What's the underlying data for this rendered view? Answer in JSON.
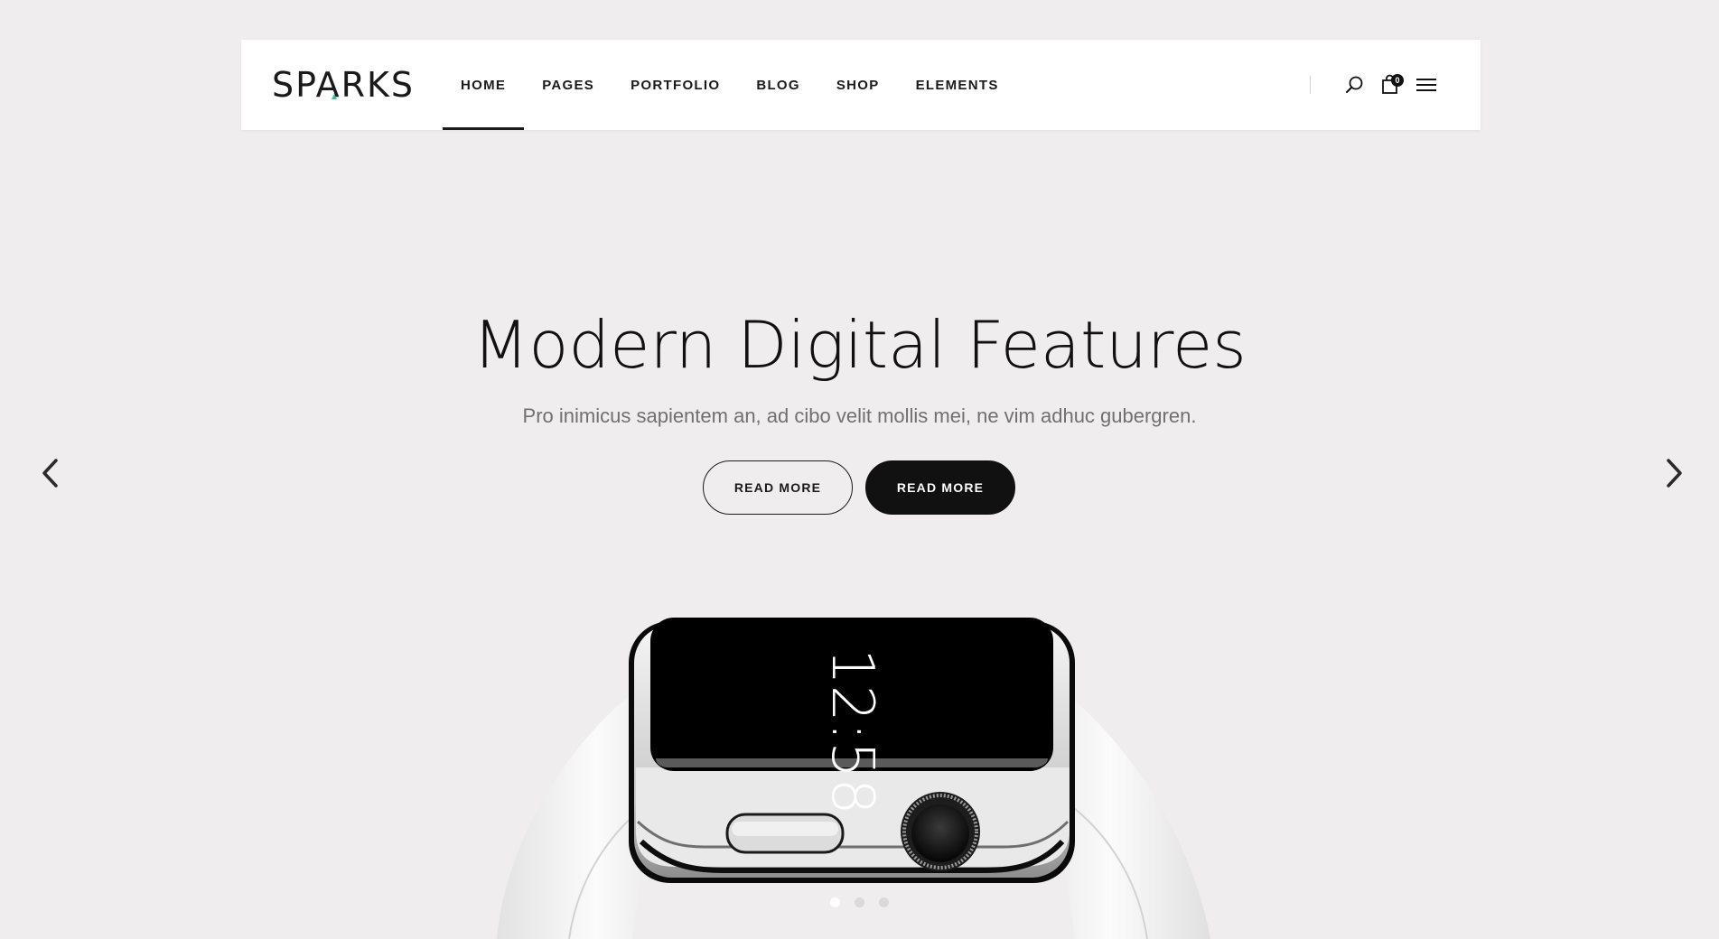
{
  "brand": {
    "logo_text": "SPARKS"
  },
  "nav": {
    "items": [
      {
        "label": "HOME",
        "active": true
      },
      {
        "label": "PAGES"
      },
      {
        "label": "PORTFOLIO"
      },
      {
        "label": "BLOG"
      },
      {
        "label": "SHOP"
      },
      {
        "label": "ELEMENTS"
      }
    ]
  },
  "header_tools": {
    "search_icon": "search-icon",
    "cart_icon": "shopping-bag-icon",
    "cart_count": "0",
    "menu_icon": "hamburger-menu-icon"
  },
  "hero": {
    "title": "Modern Digital Features",
    "subtitle": "Pro inimicus sapientem an, ad cibo velit mollis mei, ne vim adhuc gubergren.",
    "button_outline_label": "READ MORE",
    "button_solid_label": "READ MORE",
    "watch_time": "12:58"
  },
  "slider": {
    "prev_icon": "chevron-left-icon",
    "next_icon": "chevron-right-icon",
    "slide_count": 3,
    "active_slide": 1
  },
  "colors": {
    "background": "#efedee",
    "header_bg": "#ffffff",
    "text": "#111111",
    "subtitle": "#707070",
    "logo_accent": "#2bc49b"
  }
}
